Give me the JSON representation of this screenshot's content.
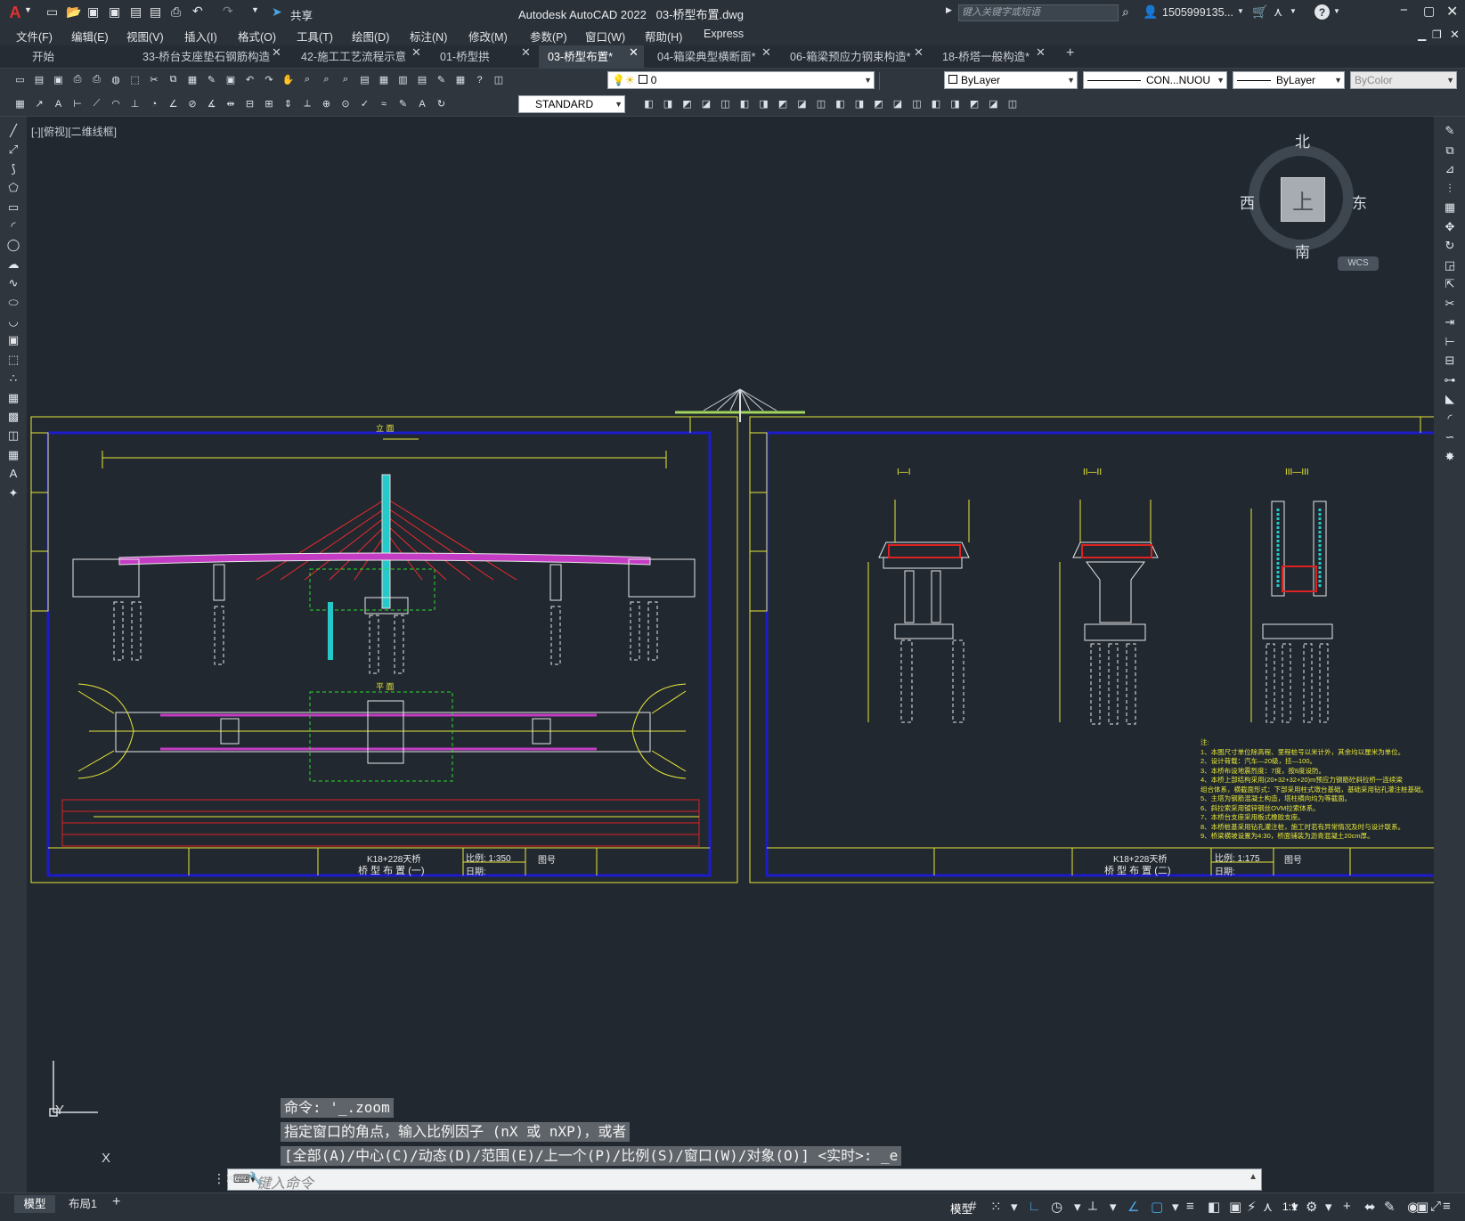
{
  "app": {
    "title": "Autodesk AutoCAD 2022",
    "file": "03-桥型布置.dwg",
    "share": "共享",
    "search_placeholder": "键入关键字或短语",
    "user": "1505999135..."
  },
  "menu": [
    "文件(F)",
    "编辑(E)",
    "视图(V)",
    "插入(I)",
    "格式(O)",
    "工具(T)",
    "绘图(D)",
    "标注(N)",
    "修改(M)",
    "参数(P)",
    "窗口(W)",
    "帮助(H)",
    "Express"
  ],
  "tabs": [
    {
      "label": "开始"
    },
    {
      "label": "33-桥台支座垫石钢筋构造"
    },
    {
      "label": "42-施工工艺流程示意"
    },
    {
      "label": "01-桥型拱"
    },
    {
      "label": "03-桥型布置*",
      "active": true
    },
    {
      "label": "04-箱梁典型横断面*"
    },
    {
      "label": "06-箱梁预应力钢束构造*"
    },
    {
      "label": "18-桥塔一般构造*"
    }
  ],
  "toolbar": {
    "layer": "0",
    "color": "ByLayer",
    "linetype": "CON...NUOU",
    "lineweight": "ByLayer",
    "plotstyle": "ByColor",
    "textstyle": "STANDARD"
  },
  "viewport_label": "[-][俯视][二维线框]",
  "viewcube": {
    "north": "北",
    "south": "南",
    "east": "东",
    "west": "西",
    "top": "上",
    "wcs": "WCS"
  },
  "drawing": {
    "sheet1": {
      "title": "K18+228天桥",
      "subtitle": "桥 型 布 置 (一)",
      "scale": "比例: 1:350",
      "date": "日期:",
      "drawing_no": "图号",
      "elevation_label": "立 面",
      "plan_label": "平 面"
    },
    "sheet2": {
      "title": "K18+228天桥",
      "subtitle": "桥 型 布 置 (二)",
      "scale": "比例: 1:175",
      "date": "日期:",
      "drawing_no": "图号",
      "sec1": "I—I",
      "sec2": "II—II",
      "sec3": "III—III",
      "notes": [
        "注:",
        "1、本图尺寸单位除高程、里程桩号以米计外，其余均以厘米为单位。",
        "2、设计荷载：汽车—20级，挂—100。",
        "3、本桥布设地震烈度：7度，按8度设防。",
        "4、本桥上部结构采用(20+32+32+20)m预应力钢筋砼斜拉桥一连续梁",
        "   组合体系，横截面形式：下部采用柱式墩台基础，基础采用钻孔灌注桩基础。",
        "5、主塔为钢筋混凝土构造，塔柱横向均为等截面。",
        "6、斜拉索采用镀锌钢丝OVM拉索体系。",
        "7、本桥台支座采用板式橡胶支座。",
        "8、本桥桩基采用钻孔灌注桩，施工时若有异常情况及时与设计联系。",
        "9、桥梁横坡设置为4:30，桥面铺装为沥青混凝土20cm厚。"
      ]
    }
  },
  "command": {
    "line1": "命令: '_.zoom",
    "line2": "指定窗口的角点，输入比例因子 (nX 或 nXP)，或者",
    "line3": "[全部(A)/中心(C)/动态(D)/范围(E)/上一个(P)/比例(S)/窗口(W)/对象(O)] <实时>: _e",
    "placeholder": "键入命令"
  },
  "layout_tabs": [
    "模型",
    "布局1"
  ],
  "status": {
    "model": "模型",
    "scale": "1:1"
  }
}
